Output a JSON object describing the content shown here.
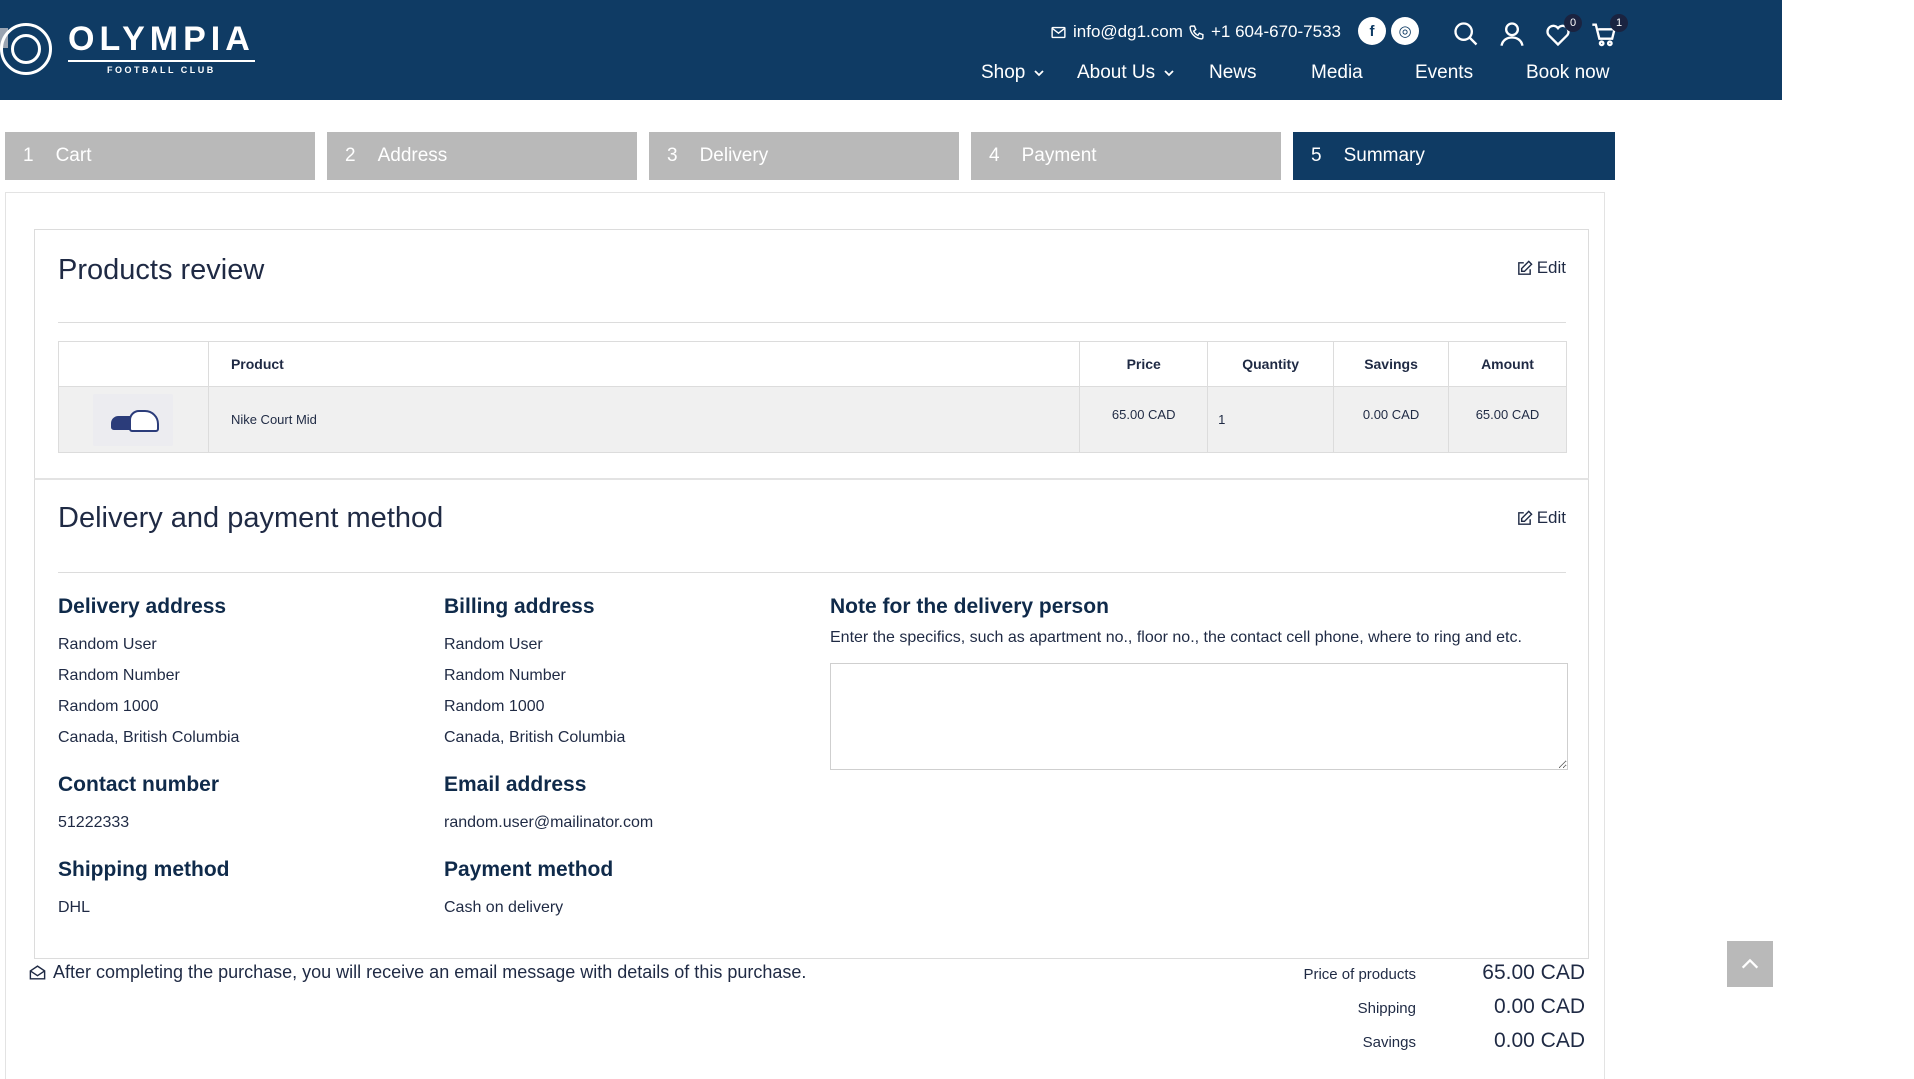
{
  "header": {
    "logo_name": "OLYMPIA",
    "logo_sub": "FOOTBALL CLUB",
    "email": "info@dg1.com",
    "phone": "+1 604-670-7533",
    "wishlist_count": "0",
    "cart_count": "1",
    "social": [
      {
        "icon": "facebook-icon",
        "glyph": "f"
      },
      {
        "icon": "instagram-icon",
        "glyph": "◎"
      }
    ],
    "nav": [
      {
        "label": "Shop",
        "dropdown": true
      },
      {
        "label": "About Us",
        "dropdown": true
      },
      {
        "label": "News",
        "dropdown": false
      },
      {
        "label": "Media",
        "dropdown": false
      },
      {
        "label": "Events",
        "dropdown": false
      },
      {
        "label": "Book now",
        "dropdown": false
      }
    ]
  },
  "steps": [
    {
      "num": "1",
      "label": "Cart",
      "active": false
    },
    {
      "num": "2",
      "label": "Address",
      "active": false
    },
    {
      "num": "3",
      "label": "Delivery",
      "active": false
    },
    {
      "num": "4",
      "label": "Payment",
      "active": false
    },
    {
      "num": "5",
      "label": "Summary",
      "active": true
    }
  ],
  "products_review": {
    "title": "Products review",
    "edit": "Edit",
    "columns": [
      "",
      "Product",
      "Price",
      "Quantity",
      "Savings",
      "Amount"
    ],
    "rows": [
      {
        "image": "shoe-image",
        "product": "Nike Court Mid",
        "price": "65.00 CAD",
        "quantity": "1",
        "savings": "0.00 CAD",
        "amount": "65.00 CAD"
      }
    ]
  },
  "delivery": {
    "title": "Delivery and payment method",
    "edit": "Edit",
    "delivery_address": {
      "heading": "Delivery address",
      "lines": [
        "Random User",
        "Random Number",
        "Random 1000",
        "Canada, British Columbia"
      ]
    },
    "billing_address": {
      "heading": "Billing address",
      "lines": [
        "Random User",
        "Random Number",
        "Random 1000",
        "Canada, British Columbia"
      ]
    },
    "contact": {
      "heading": "Contact number",
      "value": "51222333"
    },
    "email": {
      "heading": "Email address",
      "value": "random.user@mailinator.com"
    },
    "shipping": {
      "heading": "Shipping method",
      "value": "DHL"
    },
    "payment": {
      "heading": "Payment method",
      "value": "Cash on delivery"
    },
    "note": {
      "heading": "Note for the delivery person",
      "text": "Enter the specifics, such as apartment no., floor no., the contact cell phone, where to ring and etc.",
      "value": ""
    }
  },
  "footer": {
    "email_note": "After completing the purchase, you will receive an email message with details of this purchase.",
    "summary": [
      {
        "label": "Price of products",
        "value": "65.00 CAD"
      },
      {
        "label": "Shipping",
        "value": "0.00 CAD"
      },
      {
        "label": "Savings",
        "value": "0.00 CAD"
      }
    ]
  }
}
